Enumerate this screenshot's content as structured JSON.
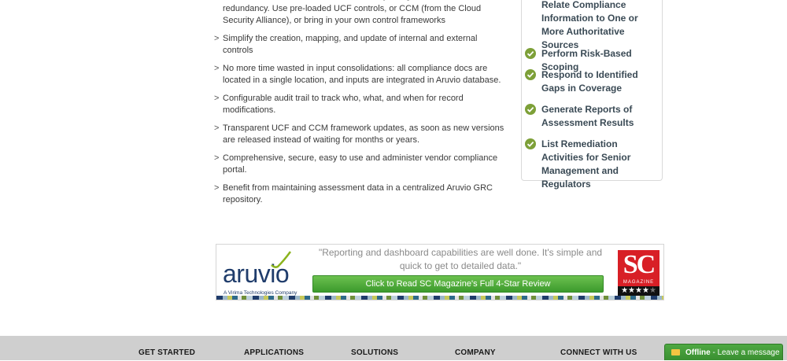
{
  "features": [
    "Works with common control frameworks by design to eliminate redundancy. Use pre-loaded UCF controls, or CCM (from the Cloud Security Alliance), or bring in your own control frameworks",
    "Simplify the creation, mapping, and update of internal and external controls",
    "No more time wasted in input consolidations: all compliance docs are located in a single location, and inputs are integrated in Aruvio database.",
    "Configurable audit trail to track who, what, and when for record modifications.",
    "Transparent UCF and CCM framework updates, as soon as new versions are released instead of waiting for months or years.",
    "Comprehensive, secure, easy to use and administer vendor compliance portal.",
    "Benefit from maintaining assessment data in a centralized Aruvio GRC repository."
  ],
  "checklist": [
    "Relate Compliance Information to One or More Authoritative Sources",
    "Perform Risk-Based Scoping",
    "Respond to Identified Gaps in Coverage",
    "Generate Reports of Assessment Results",
    "List Remediation Activities for Senior Management and Regulators"
  ],
  "banner": {
    "logo_word": "aruvio",
    "logo_tagline": "A Virima Technologies Company",
    "quote": "\"Reporting and dashboard capabilities are well done. It's simple and quick to get to detailed data.\"",
    "button_label": "Click to Read SC Magazine's Full 4-Star Review",
    "badge_top": "SC",
    "badge_sub": "MAGAZINE",
    "badge_rating": 4,
    "badge_rating_max": 5
  },
  "footer": {
    "links": [
      "GET STARTED",
      "APPLICATIONS",
      "SOLUTIONS",
      "COMPANY",
      "CONNECT WITH US"
    ]
  },
  "chat": {
    "status": "Offline",
    "separator": " - ",
    "message": "Leave a message"
  },
  "colors": {
    "check_green": "#7da038",
    "button_green": "#4ea842",
    "brand_navy": "#1f3c6b",
    "sc_red": "#d81f26",
    "footer_gray": "#cfcfcf"
  }
}
